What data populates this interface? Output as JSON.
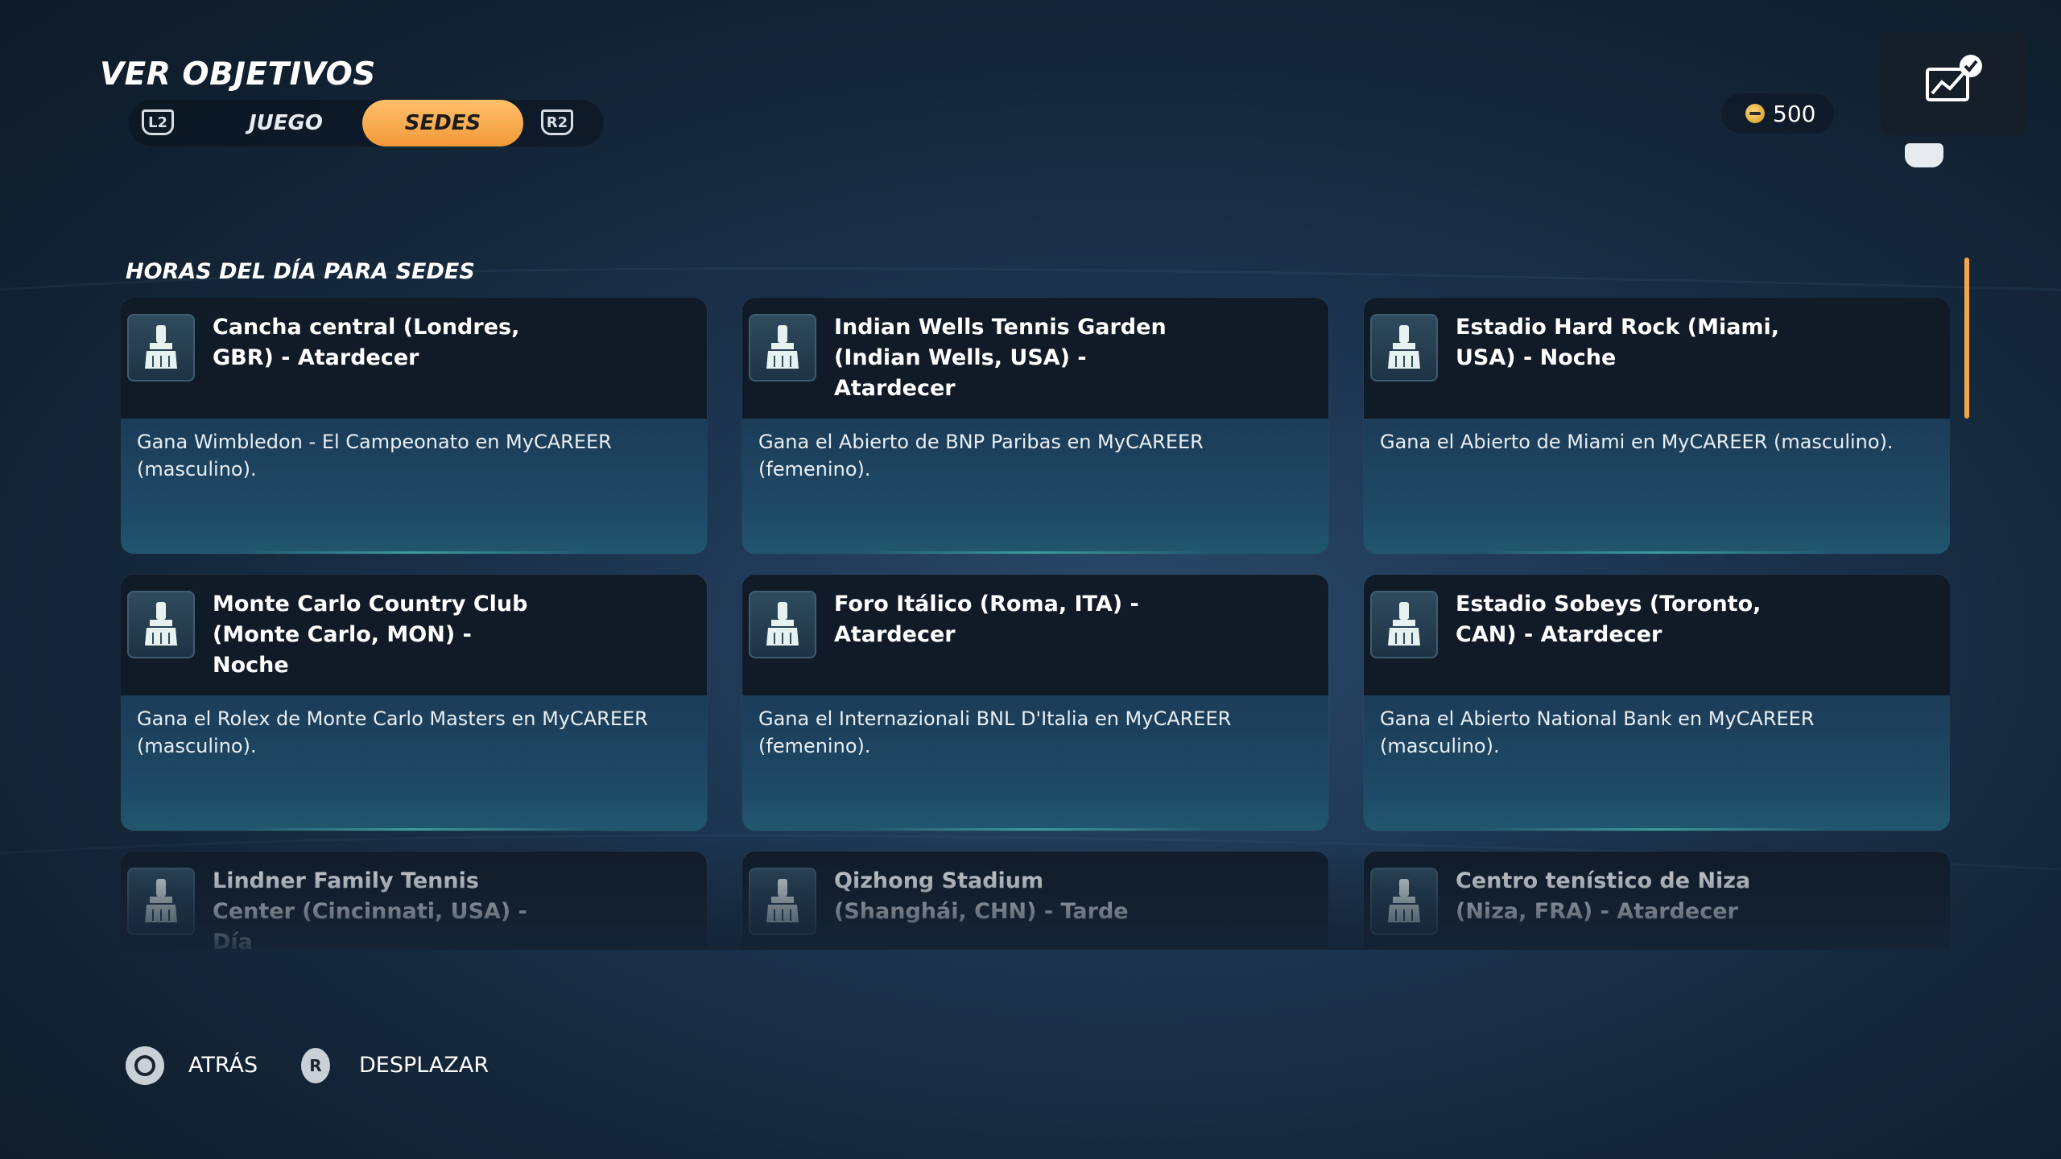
{
  "header": {
    "title": "VER OBJETIVOS",
    "left_trigger": "L2",
    "right_trigger": "R2",
    "tabs": [
      {
        "label": "JUEGO",
        "active": false
      },
      {
        "label": "SEDES",
        "active": true
      }
    ],
    "coins": "500"
  },
  "section": {
    "title": "HORAS DEL DÍA PARA SEDES"
  },
  "cards": [
    {
      "title": "Cancha central (Londres, GBR) - Atardecer",
      "desc": "Gana Wimbledon - El Campeonato en MyCAREER (masculino)."
    },
    {
      "title": "Indian Wells Tennis Garden (Indian Wells, USA) - Atardecer",
      "desc": "Gana el Abierto de BNP Paribas en MyCAREER (femenino)."
    },
    {
      "title": "Estadio Hard Rock (Miami, USA) - Noche",
      "desc": "Gana el Abierto de Miami en MyCAREER (masculino)."
    },
    {
      "title": "Monte Carlo Country Club (Monte Carlo, MON) - Noche",
      "desc": "Gana el Rolex de Monte Carlo Masters en MyCAREER (masculino)."
    },
    {
      "title": "Foro Itálico (Roma, ITA) - Atardecer",
      "desc": "Gana el Internazionali BNL D'Italia en MyCAREER (femenino)."
    },
    {
      "title": "Estadio Sobeys (Toronto, CAN) - Atardecer",
      "desc": "Gana el Abierto National Bank en MyCAREER (masculino)."
    },
    {
      "title": "Lindner Family Tennis Center (Cincinnati, USA) - Día",
      "desc": ""
    },
    {
      "title": "Qizhong Stadium (Shanghái, CHN) - Tarde",
      "desc": ""
    },
    {
      "title": "Centro tenístico de Niza (Niza, FRA) - Atardecer",
      "desc": ""
    }
  ],
  "footer": {
    "back_label": "ATRÁS",
    "scroll_button": "R",
    "scroll_label": "DESPLAZAR"
  },
  "colors": {
    "accent": "#f2993a",
    "card_head": "#111b28",
    "card_body": "#1e4a66"
  },
  "icons": {
    "card": "brush-icon",
    "goals": "goals-chart-check-icon",
    "coin": "coin-icon",
    "back": "circle-button-icon"
  }
}
